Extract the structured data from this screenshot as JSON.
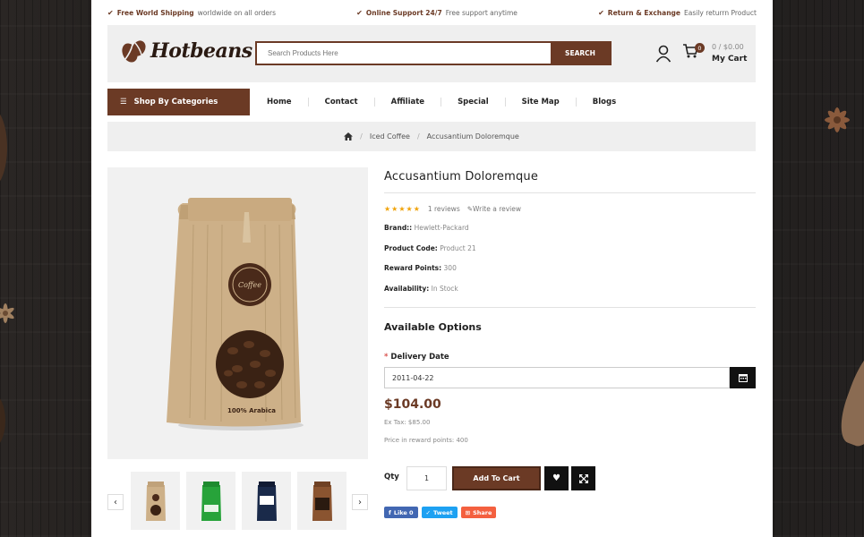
{
  "topbar": {
    "shipping_bold": "Free World Shipping",
    "shipping_rest": "worldwide on all orders",
    "support_bold": "Online Support 24/7",
    "support_rest": "Free support anytime",
    "return_bold": "Return & Exchange",
    "return_rest": "Easily returrn Product"
  },
  "header": {
    "logo_text": "Hotbeans",
    "search_placeholder": "Search Products Here",
    "search_button": "SEARCH",
    "cart_count": "0",
    "cart_total": "0 / $0.00",
    "cart_label": "My Cart"
  },
  "nav": {
    "categories": "Shop By Categories",
    "links": [
      "Home",
      "Contact",
      "Affiliate",
      "Special",
      "Site Map",
      "Blogs"
    ]
  },
  "breadcrumb": {
    "items": [
      "Iced Coffee",
      "Accusantium Doloremque"
    ]
  },
  "product": {
    "title": "Accusantium Doloremque",
    "stars": "★★★★★",
    "reviews": "1 reviews",
    "write_review": "Write a review",
    "brand_label": "Brand::",
    "brand_value": "Hewlett-Packard",
    "code_label": "Product Code:",
    "code_value": "Product 21",
    "reward_label": "Reward Points:",
    "reward_value": "300",
    "avail_label": "Availability:",
    "avail_value": "In Stock",
    "bag_label": "100% Arabica",
    "bag_badge": "Coffee"
  },
  "options": {
    "title": "Available Options",
    "delivery_label": "Delivery Date",
    "required_mark": "*",
    "delivery_value": "2011-04-22"
  },
  "pricing": {
    "price": "$104.00",
    "ex_tax": "Ex Tax: $85.00",
    "reward_price": "Price in reward points: 400"
  },
  "cart": {
    "qty_label": "Qty",
    "qty_value": "1",
    "add_button": "Add To Cart"
  },
  "share": {
    "like": "Like 0",
    "tweet": "Tweet",
    "share": "Share"
  },
  "colors": {
    "brand": "#6b3a25",
    "star": "#f0a30a",
    "dark": "#111111"
  }
}
